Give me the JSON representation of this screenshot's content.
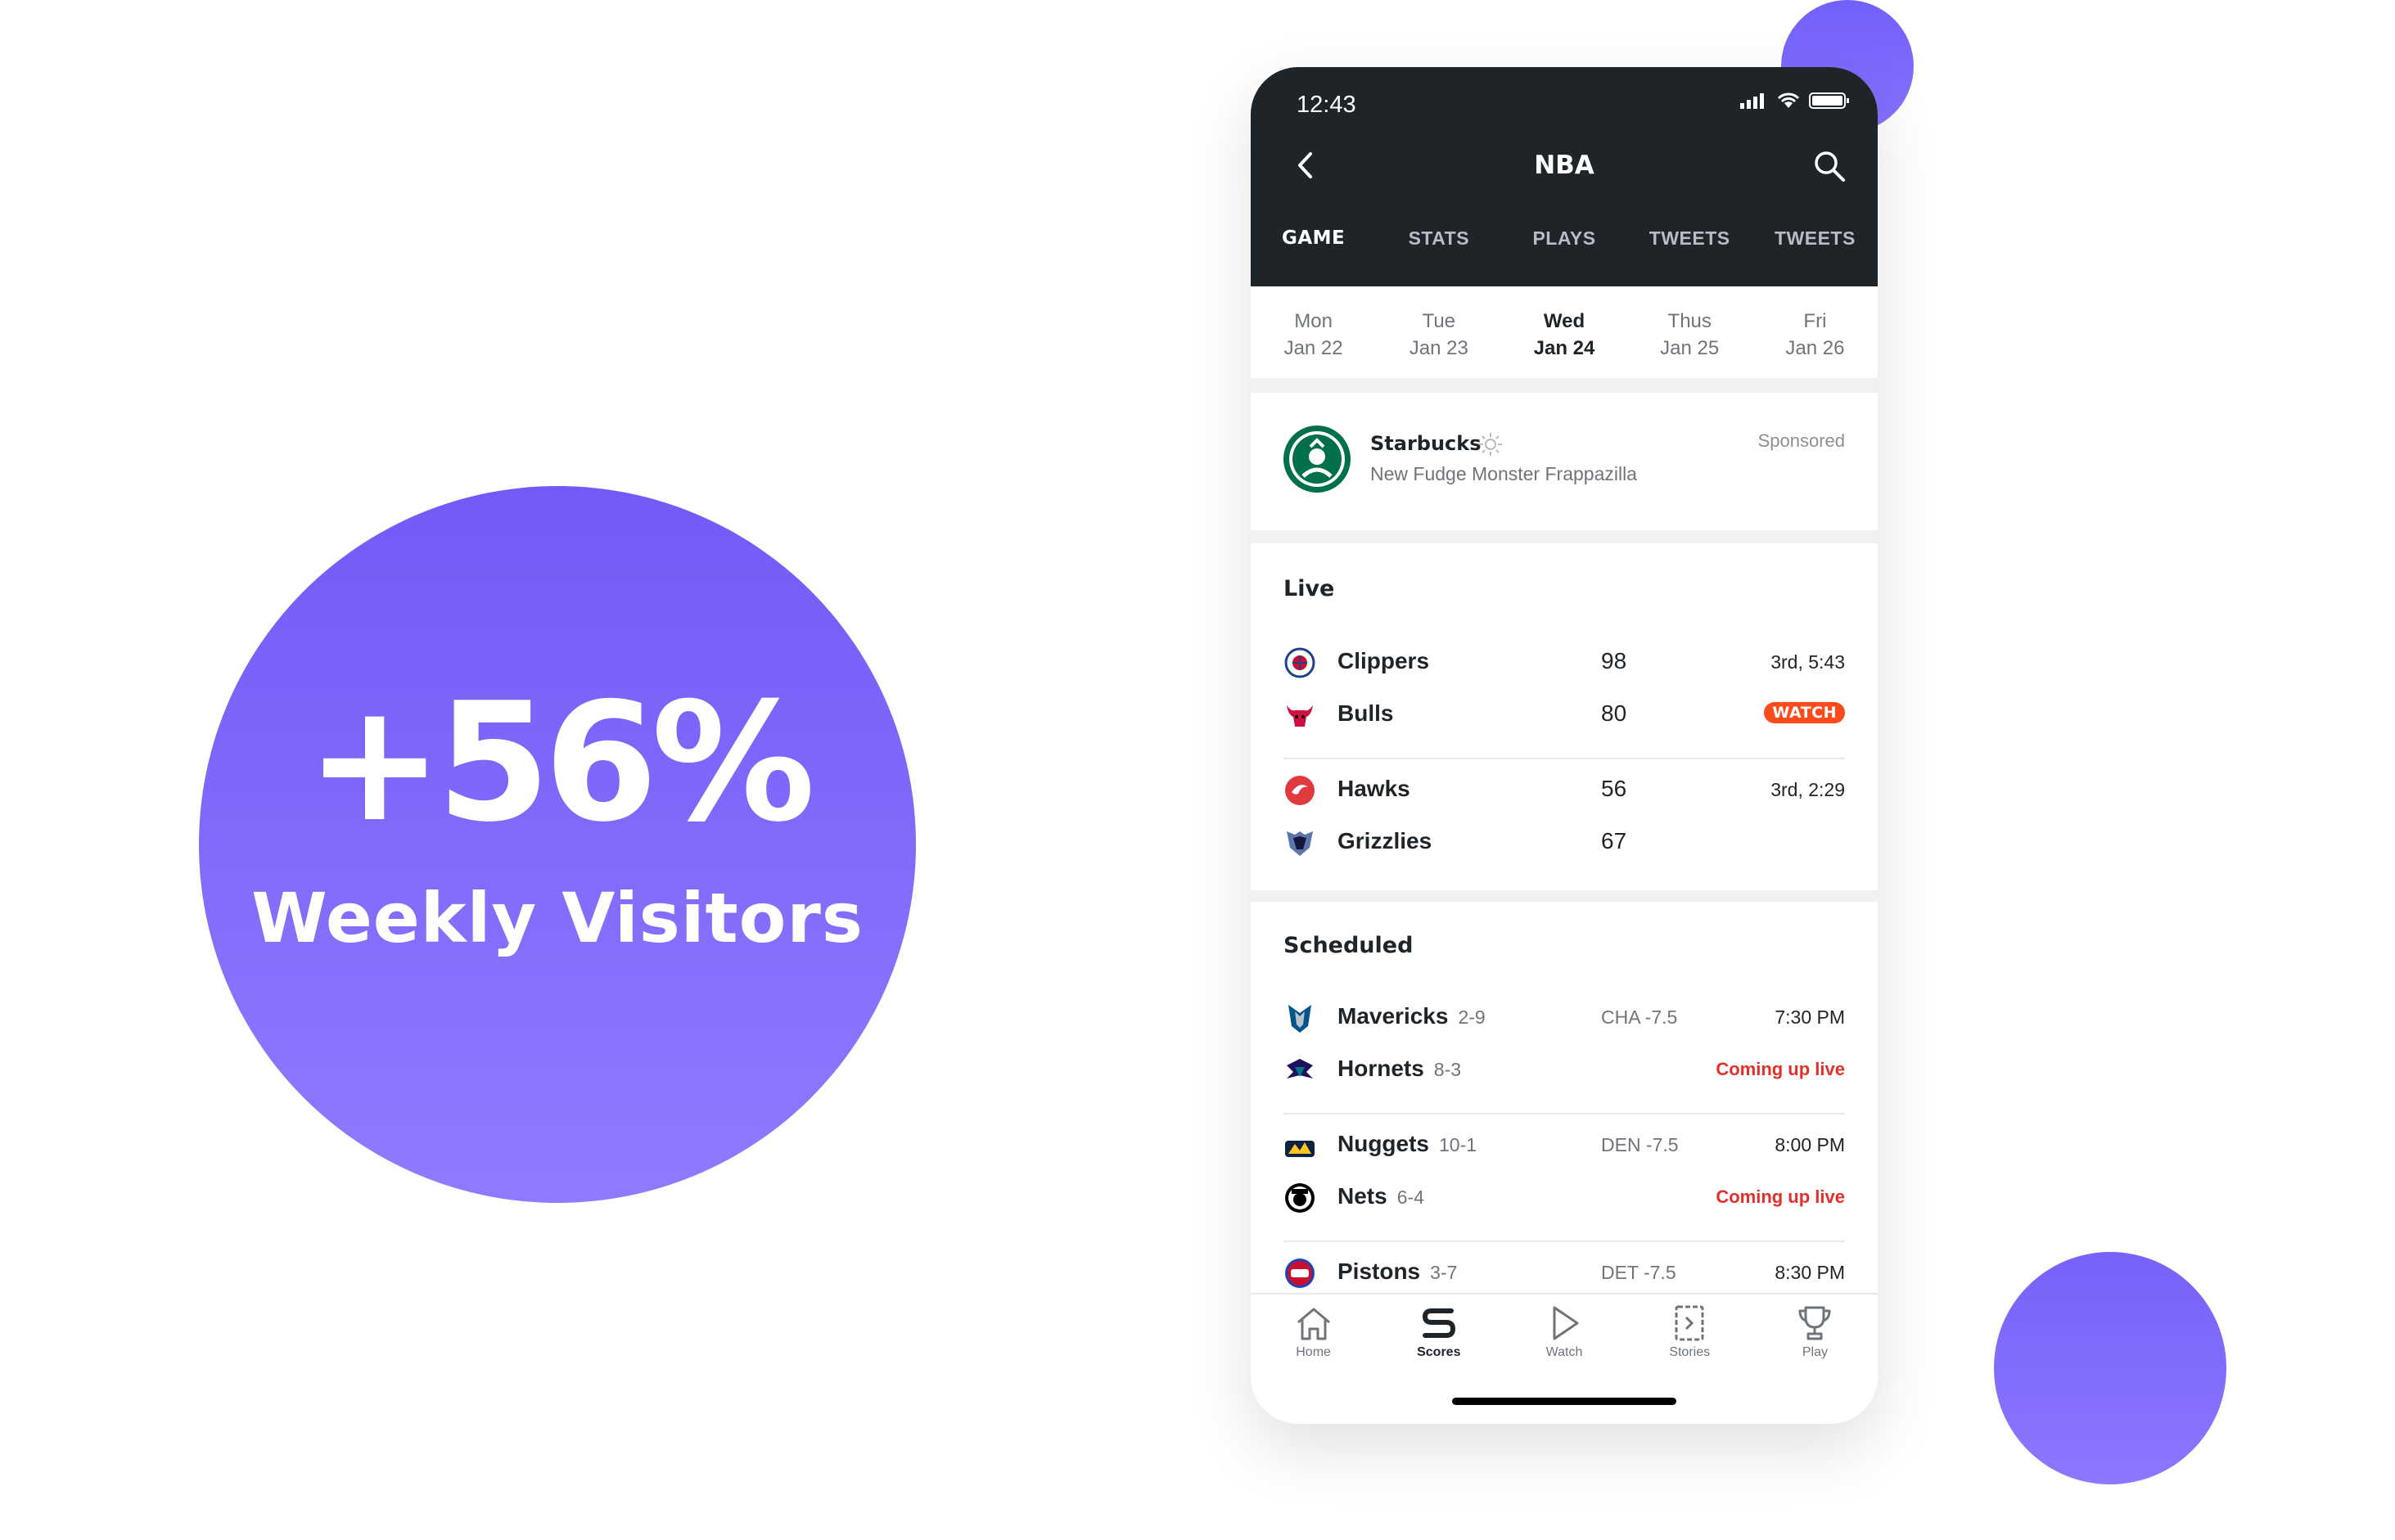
{
  "hero": {
    "value": "+56%",
    "label": "Weekly Visitors"
  },
  "colors": {
    "accent": "#7860fb",
    "header": "#1f2429",
    "watch": "#fc4c1c",
    "live_text": "#e2312b"
  },
  "status_bar": {
    "time": "12:43"
  },
  "header": {
    "title": "NBA",
    "back_icon": "chevron-left-icon",
    "search_icon": "search-icon"
  },
  "tabs": [
    {
      "label": "GAME"
    },
    {
      "label": "STATS"
    },
    {
      "label": "PLAYS"
    },
    {
      "label": "TWEETS"
    },
    {
      "label": "TWEETS"
    }
  ],
  "dates": [
    {
      "day": "Mon",
      "date": "Jan 22"
    },
    {
      "day": "Tue",
      "date": "Jan 23"
    },
    {
      "day": "Wed",
      "date": "Jan 24"
    },
    {
      "day": "Thus",
      "date": "Jan 25"
    },
    {
      "day": "Fri",
      "date": "Jan 26"
    }
  ],
  "ad": {
    "brand": "Starbucks",
    "subtitle": "New Fudge Monster Frappazilla",
    "sponsored": "Sponsored"
  },
  "live": {
    "title": "Live",
    "games": [
      {
        "team1": "Clippers",
        "score1": "98",
        "status": "3rd, 5:43",
        "team2": "Bulls",
        "score2": "80",
        "badge": "WATCH"
      },
      {
        "team1": "Hawks",
        "score1": "56",
        "status": "3rd, 2:29",
        "team2": "Grizzlies",
        "score2": "67"
      }
    ]
  },
  "scheduled": {
    "title": "Scheduled",
    "games": [
      {
        "team1": "Mavericks",
        "rec1": "2-9",
        "line": "CHA -7.5",
        "time": "7:30 PM",
        "team2": "Hornets",
        "rec2": "8-3",
        "note": "Coming up live"
      },
      {
        "team1": "Nuggets",
        "rec1": "10-1",
        "line": "DEN -7.5",
        "time": "8:00 PM",
        "team2": "Nets",
        "rec2": "6-4",
        "note": "Coming up live"
      },
      {
        "team1": "Pistons",
        "rec1": "3-7",
        "line": "DET -7.5",
        "time": "8:30 PM"
      }
    ]
  },
  "bottom_nav": [
    {
      "label": "Home",
      "icon": "home-icon"
    },
    {
      "label": "Scores",
      "icon": "scores-icon"
    },
    {
      "label": "Watch",
      "icon": "play-icon"
    },
    {
      "label": "Stories",
      "icon": "stories-icon"
    },
    {
      "label": "Play",
      "icon": "trophy-icon"
    }
  ]
}
